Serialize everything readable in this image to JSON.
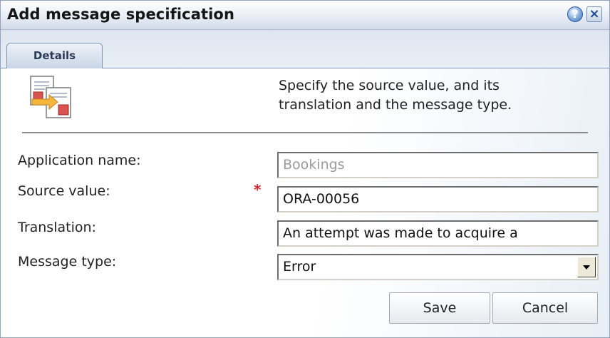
{
  "dialog": {
    "title": "Add message specification",
    "help_label": "?",
    "close_label": "×"
  },
  "tabs": [
    {
      "label": "Details",
      "active": true
    }
  ],
  "content": {
    "icon": "translation-document-icon",
    "description_line1": "Specify the source value, and its",
    "description_line2": "translation and the message type."
  },
  "form": {
    "application_name": {
      "label": "Application name:",
      "value": "Bookings",
      "disabled": true
    },
    "source_value": {
      "label": "Source value:",
      "value": "ORA-00056",
      "required_marker": "*"
    },
    "translation": {
      "label": "Translation:",
      "value": "An attempt was made to acquire a"
    },
    "message_type": {
      "label": "Message type:",
      "selected": "Error"
    }
  },
  "buttons": {
    "save_label": "Save",
    "cancel_label": "Cancel"
  },
  "colors": {
    "required": "#d0282e",
    "title_gradient_end": "#d3dcea",
    "tab_border": "#7f96b6"
  }
}
